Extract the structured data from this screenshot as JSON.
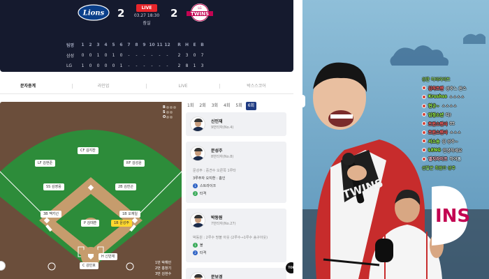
{
  "scoreboard": {
    "home_logo_text": "Lions",
    "away_logo_text": "TWINS",
    "away_logo_top": "LG",
    "home_score": "2",
    "away_score": "2",
    "live_label": "LIVE",
    "date_time": "03.27 18:30",
    "venue": "잠실",
    "linescore": {
      "header": [
        "팀명",
        "1",
        "2",
        "3",
        "4",
        "5",
        "6",
        "7",
        "8",
        "9",
        "10",
        "11",
        "12",
        "R",
        "H",
        "E",
        "B"
      ],
      "rows": [
        {
          "team": "삼성",
          "cells": [
            "0",
            "0",
            "1",
            "0",
            "1",
            "0",
            "-",
            "-",
            "-",
            "-",
            "-",
            "-",
            "2",
            "3",
            "0",
            "7"
          ]
        },
        {
          "team": "LG",
          "cells": [
            "1",
            "0",
            "0",
            "0",
            "0",
            "1",
            "-",
            "-",
            "-",
            "-",
            "-",
            "-",
            "2",
            "8",
            "1",
            "3"
          ]
        }
      ]
    }
  },
  "tabs": [
    "문자중계",
    "라인업",
    "LIVE",
    "박스스코어"
  ],
  "field": {
    "bso": {
      "b": "B",
      "s": "S",
      "o": "O"
    },
    "positions": {
      "cf": "CF 김지찬",
      "lf": "LF 김현준",
      "rf": "RF 김성윤",
      "ss": "SS 김영웅",
      "b2": "2B 김헌곤",
      "b3": "3B 맥키넌",
      "b1": "1B 오재일",
      "p": "P 김태훈",
      "runner": "1B 문성주",
      "c": "C 강민호",
      "h": "H 신민재"
    },
    "lineup": [
      "1번 박해민",
      "2번 홍창기",
      "3번 김현수"
    ]
  },
  "innings": [
    "1회",
    "2회",
    "3회",
    "4회",
    "5회",
    "6회"
  ],
  "active_inning": "6회",
  "feed": [
    {
      "name": "신민재",
      "info": "9번타자(No.4)",
      "events": []
    },
    {
      "name": "문성주",
      "info": "8번타자(No.8)",
      "events": [
        {
          "type": "text",
          "text": "문성주 : 중견수 오른쪽 1루타"
        },
        {
          "type": "text",
          "text": "3루주자 오지환 : 홈인",
          "dark": true
        },
        {
          "type": "dot",
          "color": "blue",
          "num": "1",
          "text": "스트라이크"
        },
        {
          "type": "dot",
          "color": "green",
          "num": "2",
          "text": "타격"
        }
      ]
    },
    {
      "name": "박동원",
      "info": "7번타자(No.27)",
      "events": [
        {
          "type": "text",
          "text": "박동원 : 2루수 땅볼 아웃 (2루수→1루수 송구아웃)"
        },
        {
          "type": "dot",
          "color": "green",
          "num": "1",
          "text": "볼"
        },
        {
          "type": "dot",
          "color": "blue",
          "num": "2",
          "text": "타격"
        }
      ]
    },
    {
      "name": "문보경",
      "info": "6번타자(No.2)",
      "events": []
    }
  ],
  "top_button": "TOP",
  "chat": [
    {
      "user": "",
      "msg": "강한 하이라이트",
      "color": "green"
    },
    {
      "user": "김하트맨",
      "msg": "성주느 윈스",
      "color": "red"
    },
    {
      "user": "Krushss",
      "msg": "ㅅㅅㅅㅅ",
      "color": "green"
    },
    {
      "user": "현규~",
      "msg": "ㅅㅅㅅㅅ",
      "color": "green"
    },
    {
      "user": "임정소년",
      "msg": "타!",
      "color": "green"
    },
    {
      "user": "트윈스팬사",
      "msg": "ttt",
      "color": "red"
    },
    {
      "user": "트윈스팬사",
      "msg": "ㅅㅅㅅ",
      "color": "red"
    },
    {
      "user": "서소송",
      "msg": "김 성주~",
      "color": "green"
    },
    {
      "user": "LENG",
      "msg": "안녕하세요",
      "color": "green"
    },
    {
      "user": "엘지라이프",
      "msg": "하여튼",
      "color": "pink"
    },
    {
      "user": "",
      "msg": "선발은 최원으 성주",
      "color": "green"
    }
  ],
  "stream_jersey_text": "TWINS",
  "stream_banner_text": "INS"
}
